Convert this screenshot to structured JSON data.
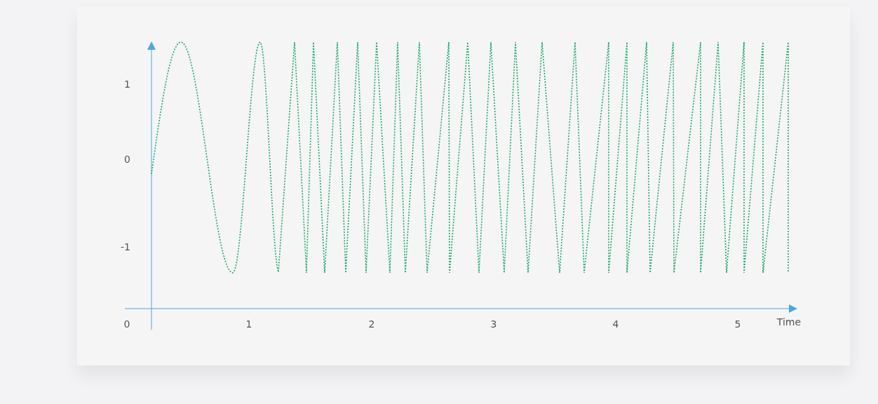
{
  "chart": {
    "y_tick_labels": [
      "1",
      "0",
      "-1"
    ],
    "x_tick_labels": [
      "0",
      "1",
      "2",
      "3",
      "4",
      "5"
    ],
    "x_axis_label": "Time"
  }
}
